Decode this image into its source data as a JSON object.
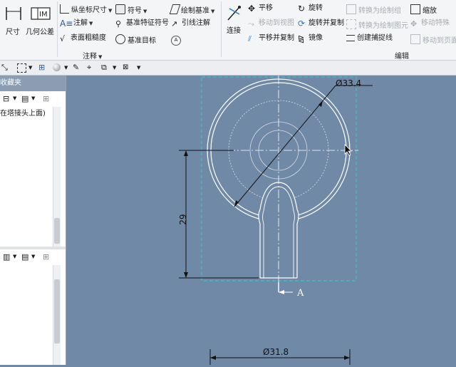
{
  "ribbon": {
    "left_tools": {
      "dim_label": "尺寸",
      "gtol_label": "几何公差"
    },
    "annotation": {
      "ordinate_dim": "纵坐标尺寸",
      "note": "注解",
      "surface_finish": "表面粗糙度",
      "symbol": "符号",
      "datum_feature": "基准特征符号",
      "datum_target": "基准目标",
      "draw_datum": "绘制基准",
      "leader_note": "引线注解",
      "group_label": "注释"
    },
    "edit": {
      "connect": "连接",
      "translate": "平移",
      "move_to_view": "移动到视图",
      "translate_copy": "平移并复制",
      "rotate": "旋转",
      "rotate_copy": "旋转并复制",
      "mirror": "镜像",
      "convert_draw_group": "转换为绘制组",
      "convert_draw_element": "转换为绘制图元",
      "create_snap_line": "创建捕捉线",
      "scale": "缩放",
      "move_special": "移动特殊",
      "move_to_page": "移动到页面",
      "group_label": "编辑"
    }
  },
  "panel": {
    "title": "收藏夹",
    "item": "在塔接头上面)"
  },
  "drawing": {
    "dim_large_diameter": "Ø33.4",
    "dim_height": "29",
    "dim_bottom_diameter": "Ø31.8",
    "section_label": "A"
  },
  "colors": {
    "canvas": "#6f89a6",
    "geometry": "#ffffff",
    "dimension": "#111111",
    "view_frame": "#36c8d8",
    "ribbon": "#f4f5f7"
  }
}
